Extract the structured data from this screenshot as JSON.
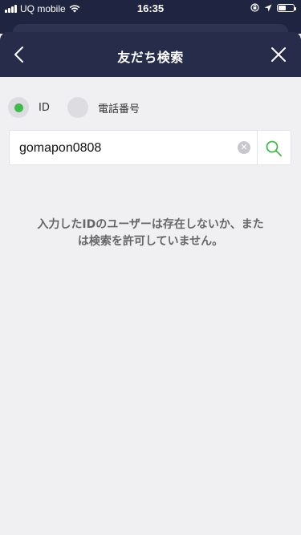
{
  "status_bar": {
    "carrier": "UQ mobile",
    "time": "16:35",
    "battery_level": 0.5
  },
  "header": {
    "title": "友だち検索",
    "back_icon": "chevron-left-icon",
    "close_icon": "close-icon"
  },
  "search_type": {
    "options": [
      {
        "label": "ID",
        "selected": true
      },
      {
        "label": "電話番号",
        "selected": false
      }
    ]
  },
  "search": {
    "value": "gomapon0808",
    "clear_icon": "clear-icon",
    "submit_icon": "search-icon"
  },
  "result": {
    "message_line1": "入力したIDのユーザーは存在しないか、また",
    "message_line2": "は検索を許可していません。"
  },
  "colors": {
    "header_bg": "#262c4a",
    "accent_green": "#3fb94c",
    "page_bg": "#f0f0f3"
  }
}
